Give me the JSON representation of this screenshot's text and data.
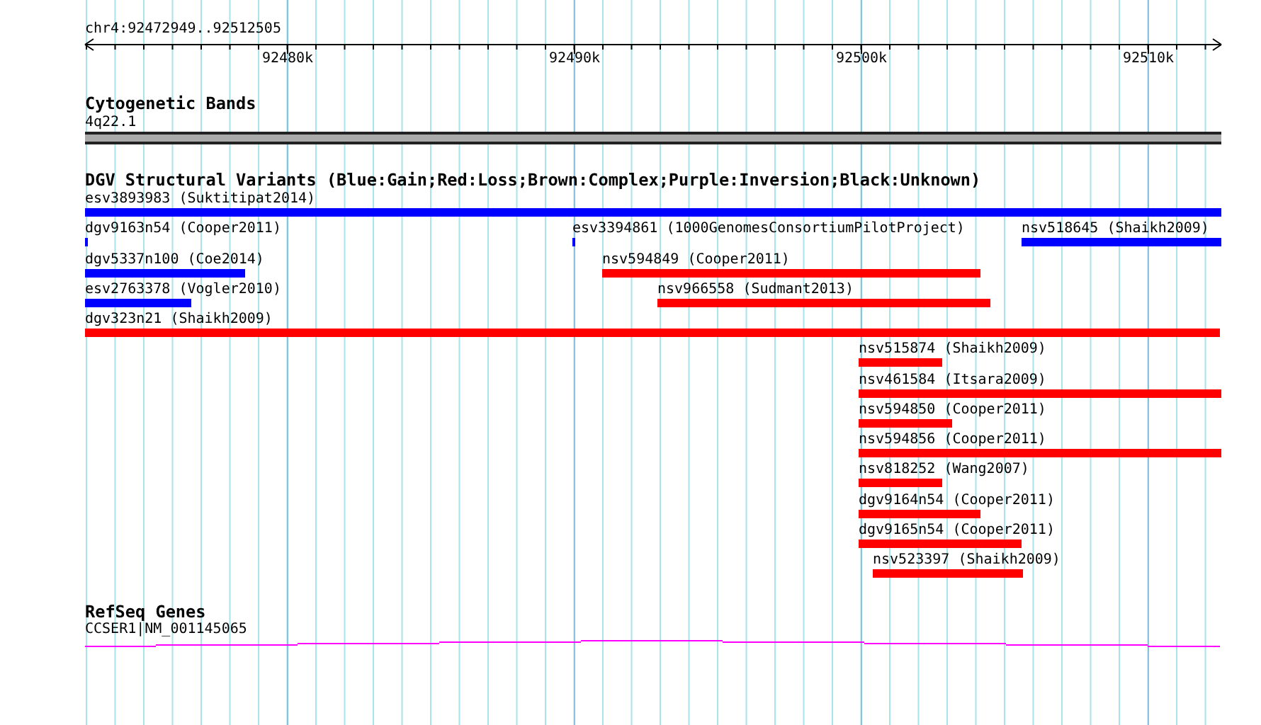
{
  "ruler": {
    "location": "chr4:92472949..92512505",
    "ticks": [
      "92480k",
      "92490k",
      "92500k",
      "92510k"
    ]
  },
  "tracks": [
    {
      "kind": "bands",
      "title": "Cytogenetic Bands",
      "features": [
        {
          "label": "4q22.1"
        }
      ]
    },
    {
      "kind": "variants",
      "title": "DGV Structural Variants (Blue:Gain;Red:Loss;Brown:Complex;Purple:Inversion;Black:Unknown)",
      "rows": [
        [
          {
            "label": "esv3893983 (Suktitipat2014)",
            "color": "#0000ff"
          }
        ],
        [
          {
            "label": "dgv9163n54 (Cooper2011)",
            "color": "#0000ff"
          },
          {
            "label": "esv3394861 (1000GenomesConsortiumPilotProject)",
            "color": "#0000ff"
          },
          {
            "label": "nsv518645 (Shaikh2009)",
            "color": "#0000ff"
          }
        ],
        [
          {
            "label": "dgv5337n100 (Coe2014)",
            "color": "#0000ff"
          },
          {
            "label": "nsv594849 (Cooper2011)",
            "color": "#ff0000"
          }
        ],
        [
          {
            "label": "esv2763378 (Vogler2010)",
            "color": "#0000ff"
          },
          {
            "label": "nsv966558 (Sudmant2013)",
            "color": "#ff0000"
          }
        ],
        [
          {
            "label": "dgv323n21 (Shaikh2009)",
            "color": "#ff0000"
          }
        ],
        [
          {
            "label": "nsv515874 (Shaikh2009)",
            "color": "#ff0000"
          }
        ],
        [
          {
            "label": "nsv461584 (Itsara2009)",
            "color": "#ff0000"
          }
        ],
        [
          {
            "label": "nsv594850 (Cooper2011)",
            "color": "#ff0000"
          }
        ],
        [
          {
            "label": "nsv594856 (Cooper2011)",
            "color": "#ff0000"
          }
        ],
        [
          {
            "label": "nsv818252 (Wang2007)",
            "color": "#ff0000"
          }
        ],
        [
          {
            "label": "dgv9164n54 (Cooper2011)",
            "color": "#ff0000"
          }
        ],
        [
          {
            "label": "dgv9165n54 (Cooper2011)",
            "color": "#ff0000"
          }
        ],
        [
          {
            "label": "nsv523397 (Shaikh2009)",
            "color": "#ff0000"
          }
        ]
      ]
    },
    {
      "kind": "genes",
      "title": "RefSeq Genes",
      "features": [
        {
          "label": "CCSER1|NM_001145065"
        }
      ]
    }
  ]
}
